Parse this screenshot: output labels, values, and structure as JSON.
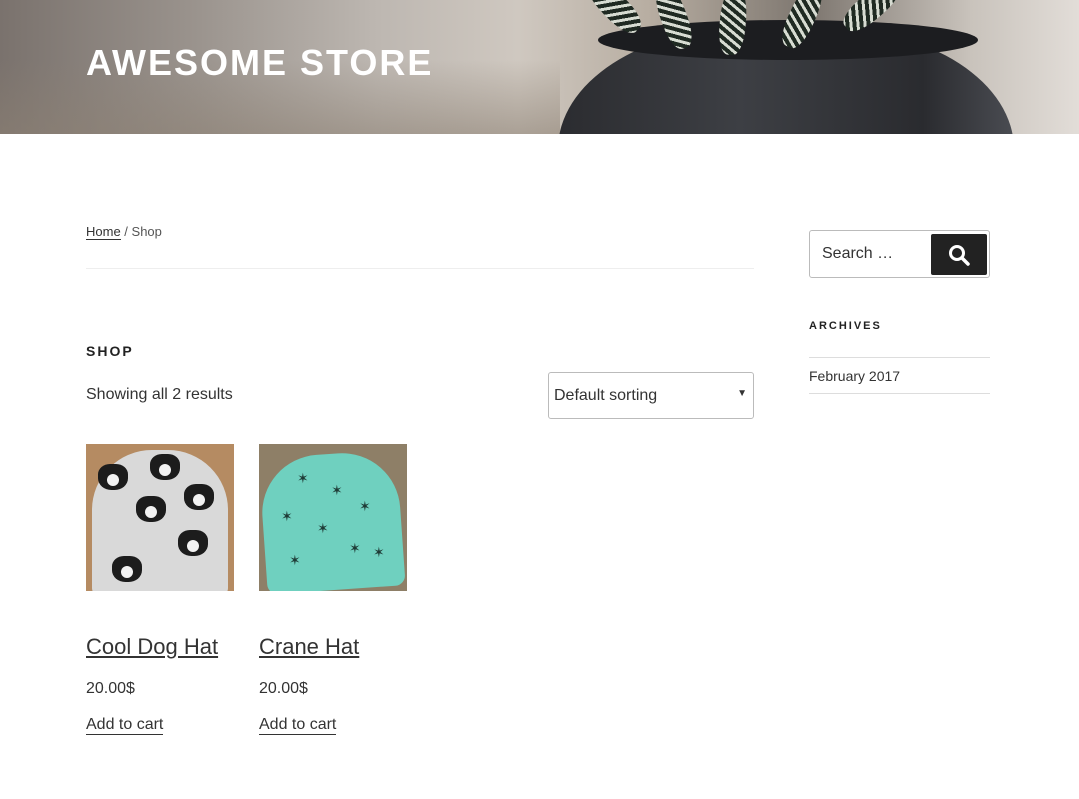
{
  "header": {
    "site_title": "AWESOME STORE"
  },
  "breadcrumb": {
    "home": "Home",
    "separator": " / ",
    "current": "Shop"
  },
  "shop": {
    "title": "SHOP",
    "result_count": "Showing all 2 results",
    "sorting": {
      "selected": "Default sorting"
    },
    "products": [
      {
        "name": "Cool Dog Hat",
        "price": "20.00$",
        "cta": "Add to cart"
      },
      {
        "name": "Crane Hat",
        "price": "20.00$",
        "cta": "Add to cart"
      }
    ]
  },
  "sidebar": {
    "search": {
      "placeholder": "Search …",
      "icon": "search-icon"
    },
    "archives": {
      "title": "ARCHIVES",
      "items": [
        "February 2017"
      ]
    }
  }
}
